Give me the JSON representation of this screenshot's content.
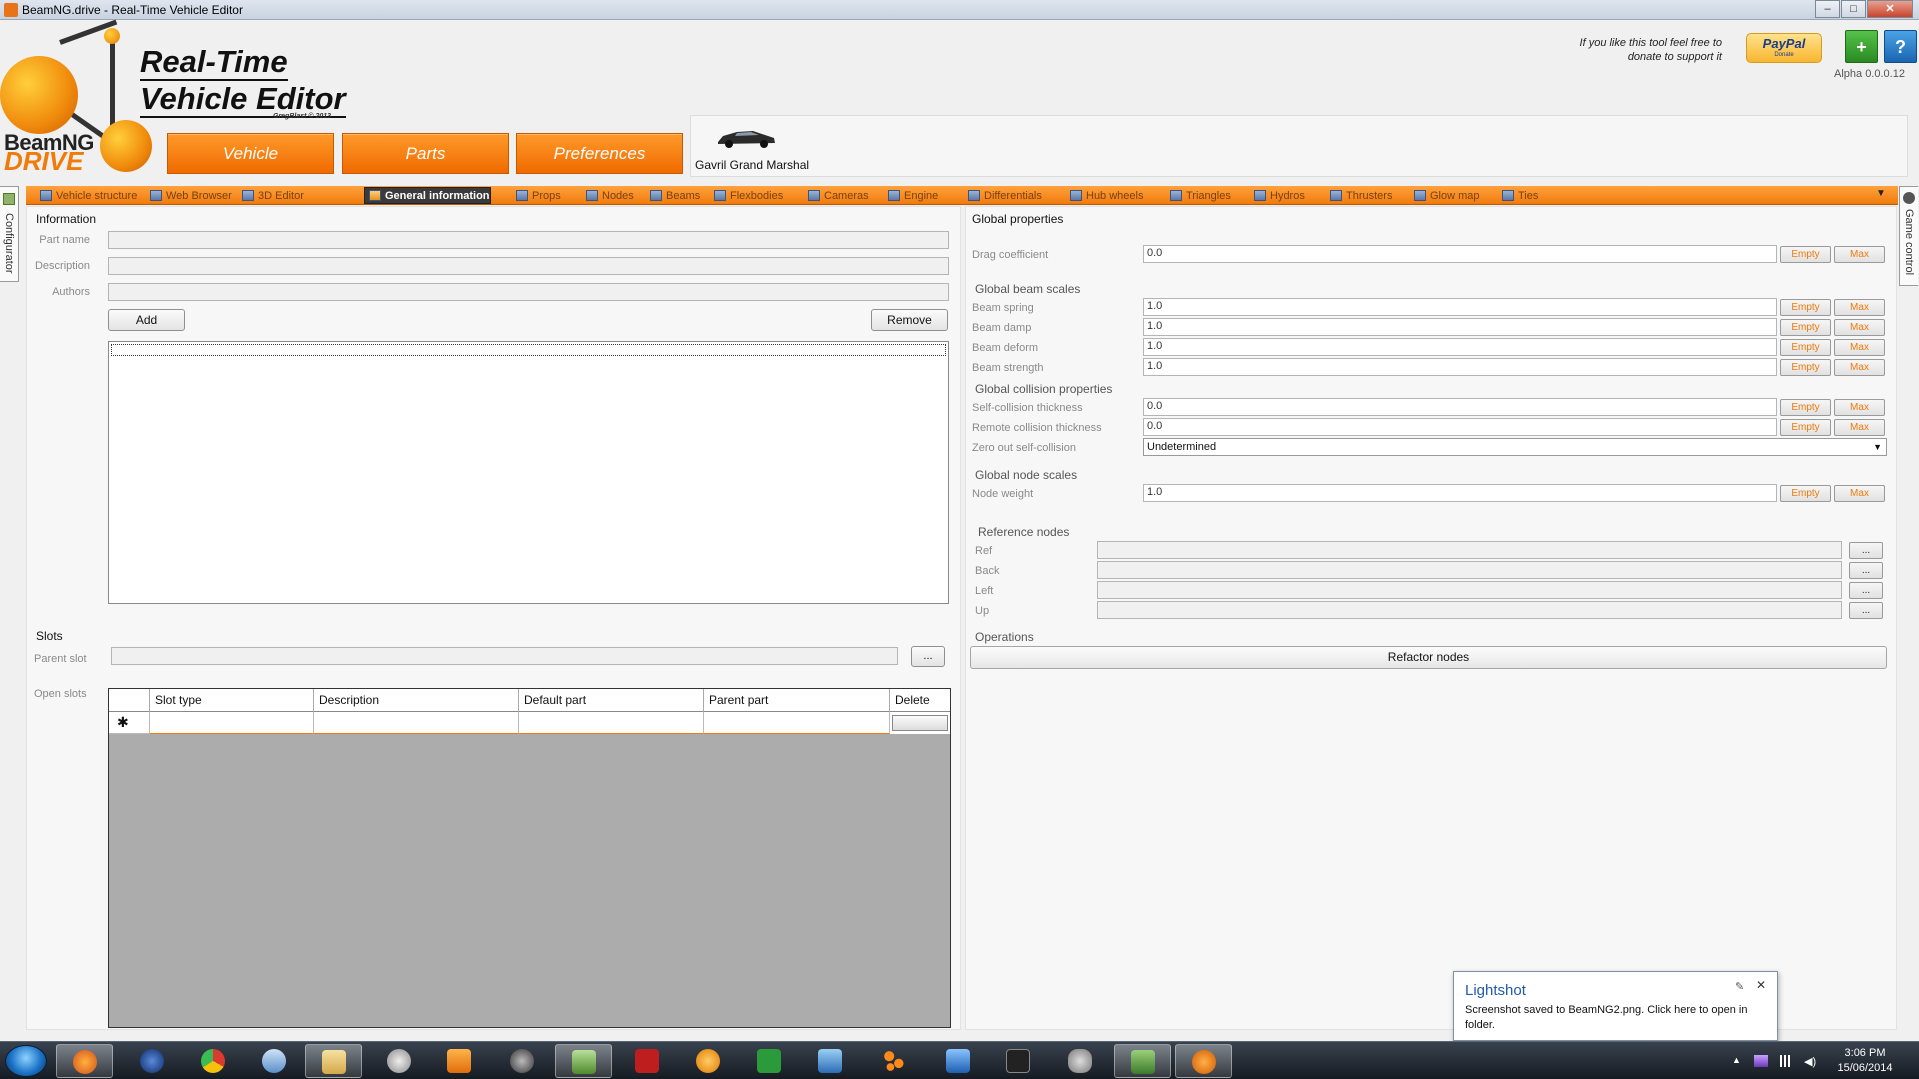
{
  "window": {
    "title": "BeamNG.drive - Real-Time Vehicle Editor",
    "controls": [
      "–",
      "□",
      "✕"
    ]
  },
  "header": {
    "brand_line1": "BeamNG",
    "brand_line2": "DRIVE",
    "editor_title_line1": "Real-Time",
    "editor_title_line2": "Vehicle Editor",
    "credit": "GregBlast © 2013",
    "nav": [
      "Vehicle",
      "Parts",
      "Preferences"
    ],
    "vehicle_name": "Gavril Grand Marshal",
    "donate_text_line1": "If you like this tool feel free to",
    "donate_text_line2": "donate to support it",
    "paypal_label": "PayPal",
    "paypal_sub": "Donate",
    "add_label": "+",
    "help_label": "?",
    "version": "Alpha 0.0.0.12"
  },
  "tabs": [
    {
      "label": "Vehicle structure",
      "active": false
    },
    {
      "label": "Web Browser",
      "active": false
    },
    {
      "label": "3D Editor",
      "active": false
    },
    {
      "label": "General information",
      "active": true
    },
    {
      "label": "Props",
      "active": false
    },
    {
      "label": "Nodes",
      "active": false
    },
    {
      "label": "Beams",
      "active": false
    },
    {
      "label": "Flexbodies",
      "active": false
    },
    {
      "label": "Cameras",
      "active": false
    },
    {
      "label": "Engine",
      "active": false
    },
    {
      "label": "Differentials",
      "active": false
    },
    {
      "label": "Hub wheels",
      "active": false
    },
    {
      "label": "Triangles",
      "active": false
    },
    {
      "label": "Hydros",
      "active": false
    },
    {
      "label": "Thrusters",
      "active": false
    },
    {
      "label": "Glow map",
      "active": false
    },
    {
      "label": "Ties",
      "active": false
    }
  ],
  "side": {
    "left_label": "Configurator",
    "right_label": "Game control"
  },
  "information": {
    "title": "Information",
    "part_name_label": "Part name",
    "part_name_value": "",
    "description_label": "Description",
    "description_value": "",
    "authors_label": "Authors",
    "authors_value": "",
    "add_label": "Add",
    "remove_label": "Remove"
  },
  "slots": {
    "title": "Slots",
    "parent_slot_label": "Parent slot",
    "parent_slot_value": "",
    "browse_label": "...",
    "open_slots_label": "Open slots",
    "columns": [
      "Slot type",
      "Description",
      "Default part",
      "Parent part",
      "Delete"
    ],
    "new_row_marker": "✱"
  },
  "global_properties": {
    "title": "Global properties",
    "empty_label": "Empty",
    "max_label": "Max",
    "drag_coefficient": {
      "label": "Drag coefficient",
      "value": "0.0"
    },
    "beam_scales_title": "Global beam scales",
    "beam_spring": {
      "label": "Beam spring",
      "value": "1.0"
    },
    "beam_damp": {
      "label": "Beam damp",
      "value": "1.0"
    },
    "beam_deform": {
      "label": "Beam deform",
      "value": "1.0"
    },
    "beam_strength": {
      "label": "Beam strength",
      "value": "1.0"
    },
    "collision_title": "Global collision properties",
    "self_collision": {
      "label": "Self-collision thickness",
      "value": "0.0"
    },
    "remote_collision": {
      "label": "Remote collision thickness",
      "value": "0.0"
    },
    "zero_out": {
      "label": "Zero out self-collision",
      "value": "Undetermined"
    },
    "node_scales_title": "Global node scales",
    "node_weight": {
      "label": "Node weight",
      "value": "1.0"
    }
  },
  "reference_nodes": {
    "title": "Reference nodes",
    "ref_label": "Ref",
    "back_label": "Back",
    "left_label": "Left",
    "up_label": "Up",
    "browse_label": "..."
  },
  "operations": {
    "title": "Operations",
    "refactor_label": "Refactor nodes"
  },
  "popup": {
    "title": "Lightshot",
    "message": "Screenshot saved to BeamNG2.png. Click here to open in folder.",
    "close": "✕",
    "pin": "✎"
  },
  "taskbar": {
    "time": "3:06 PM",
    "date": "15/06/2014"
  },
  "colors": {
    "accent": "#f07a0a",
    "popup_title": "#1f5aa8",
    "taskbar": "#1c232b"
  }
}
